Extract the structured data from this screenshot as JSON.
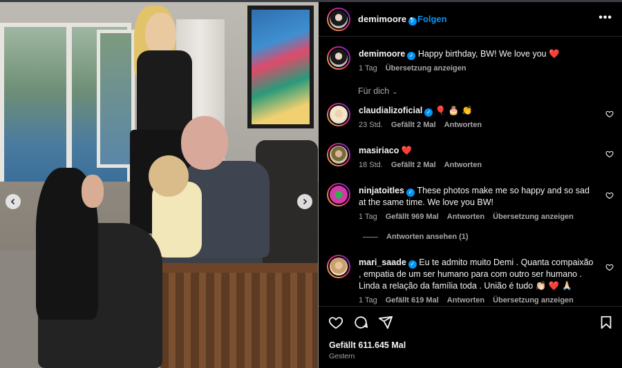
{
  "post": {
    "author": "demimoore",
    "follow_label": "Folgen",
    "dot": "•",
    "more": "•••",
    "caption": {
      "username": "demimoore",
      "text": "Happy birthday, BW! We love you ❤️",
      "age": "1 Tag",
      "translate": "Übersetzung anzeigen"
    },
    "for_you": "Für dich",
    "likes": "Gefällt 611.645 Mal",
    "date": "Gestern"
  },
  "comments": [
    {
      "username": "claudializoficial",
      "verified": true,
      "text": "🎈 🎂 👏",
      "age": "23 Std.",
      "likes": "Gefällt 2 Mal",
      "reply": "Antworten"
    },
    {
      "username": "masiriaco",
      "verified": false,
      "text": "❤️",
      "age": "18 Std.",
      "likes": "Gefällt 2 Mal",
      "reply": "Antworten"
    },
    {
      "username": "ninjatoitles",
      "verified": true,
      "text": "These photos make me so happy and so sad at the same time. We love you BW!",
      "age": "1 Tag",
      "likes": "Gefällt 969 Mal",
      "reply": "Antworten",
      "translate": "Übersetzung anzeigen"
    },
    {
      "username": "mari_saade",
      "verified": true,
      "text": "Eu te admito muito Demi . Quanta compaixão , empatia de um ser humano para com outro ser humano . Linda a relação da família toda . União é tudo 👏🏻 ❤️ 🙏🏻",
      "age": "1 Tag",
      "likes": "Gefällt 619 Mal",
      "reply": "Antworten",
      "translate": "Übersetzung anzeigen"
    }
  ],
  "view_replies": "Antworten ansehen (1)",
  "colors": {
    "accent": "#0095f6",
    "background": "#000000",
    "text": "#f5f5f5",
    "muted": "#a8a8a8",
    "heart": "#ff3040"
  },
  "icons": [
    "chevron-left-icon",
    "chevron-right-icon",
    "verified-badge-icon",
    "more-options-icon",
    "heart-icon",
    "comment-icon",
    "share-icon",
    "bookmark-icon",
    "chevron-down-icon"
  ]
}
